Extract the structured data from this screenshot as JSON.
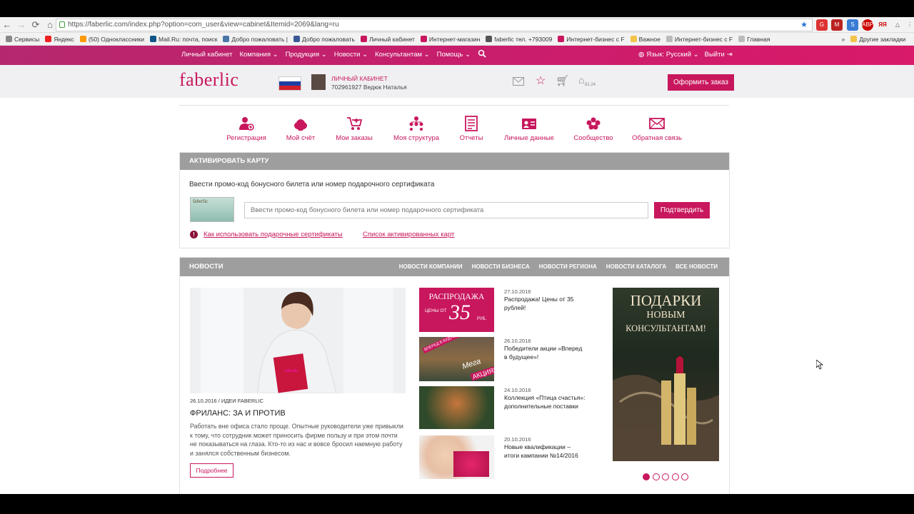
{
  "browser": {
    "url": "https://faberlic.com/index.php?option=com_user&view=cabinet&Itemid=2069&lang=ru",
    "bookmarks": [
      "Сервисы",
      "Яндекс",
      "(50) Одноклассники",
      "Mail.Ru: почта, поиск",
      "Добро пожаловать |",
      "Добро пожаловать",
      "Личный кабинет",
      "Интернет-магазин",
      "faberlic тел. +793009",
      "Интернет-бизнес с F",
      "Важное",
      "Интернет-бизнес с F",
      "Главная",
      "Другие закладки"
    ],
    "bookmark_more": "»"
  },
  "topnav": {
    "menu": [
      "Личный кабинет",
      "Компания ⌄",
      "Продукция ⌄",
      "Новости ⌄",
      "Консультантам ⌄",
      "Помощь ⌄"
    ],
    "language": "Язык: Русский ⌄",
    "logout": "Выйти"
  },
  "header": {
    "logo": "faberlic",
    "cabinet_label": "ЛИЧНЫЙ КАБИНЕТ",
    "user": "702961927 Ведюк Наталья",
    "points": "81.24",
    "order_button": "Оформить заказ"
  },
  "cabinet_menu": [
    "Регистрация",
    "Мой счёт",
    "Мои заказы",
    "Моя структура",
    "Отчеты",
    "Личные данные",
    "Сообщество",
    "Обратная связь"
  ],
  "activate": {
    "header": "АКТИВИРОВАТЬ КАРТУ",
    "title": "Ввести промо-код бонусного билета или номер подарочного сертификата",
    "card_brand": "faberlic",
    "placeholder": "Ввести промо-код бонусного билета или номер подарочного сертификата",
    "confirm": "Подтвердить",
    "info": "!",
    "link1": "Как использовать подарочные сертификаты",
    "link2": "Список активированных карт"
  },
  "news": {
    "header": "НОВОСТИ",
    "tabs": [
      "НОВОСТИ КОМПАНИИ",
      "НОВОСТИ БИЗНЕСА",
      "НОВОСТИ РЕГИОНА",
      "НОВОСТИ КАТАЛОГА",
      "ВСЕ НОВОСТИ"
    ],
    "main": {
      "date": "26.10.2016 /",
      "category": "ИДЕИ FABERLIC",
      "title": "ФРИЛАНС: ЗА И ПРОТИВ",
      "body": "Работать вне офиса стало проще. Опытные руководители уже привыкли к тому, что сотрудник может приносить фирме пользу и при этом почти не показываться на глаза. Кто-то из нас и вовсе бросил наемную работу и занялся собственным бизнесом.",
      "more": "Подробнее"
    },
    "side": [
      {
        "date": "27.10.2016",
        "title": "Распродажа! Цены от 35 рублей!"
      },
      {
        "date": "26.10.2016",
        "title": "Победители акции «Вперед в будущее»!"
      },
      {
        "date": "24.10.2016",
        "title": "Коллекция «Птица счастья»: дополнительные поставки"
      },
      {
        "date": "20.10.2016",
        "title": "Новые квалификации – итоги кампании №14/2016"
      }
    ],
    "sale_thumb": {
      "line1": "РАСПРОДАЖА",
      "line2": "ЦЕНЫ ОТ",
      "price": "35",
      "unit": "РУБ."
    },
    "mega_thumb": {
      "tag": "ВПЕРЕД В БУДУЩЕЕ",
      "mega": "Мега",
      "akcia": "АКЦИЯ!"
    },
    "banner": {
      "line1": "ПОДАРКИ",
      "line2": "НОВЫМ",
      "line3": "КОНСУЛЬТАНТАМ!"
    },
    "slides": 5
  },
  "colors": {
    "brand": "#c8175d",
    "panel_header": "#9e9e9e"
  }
}
